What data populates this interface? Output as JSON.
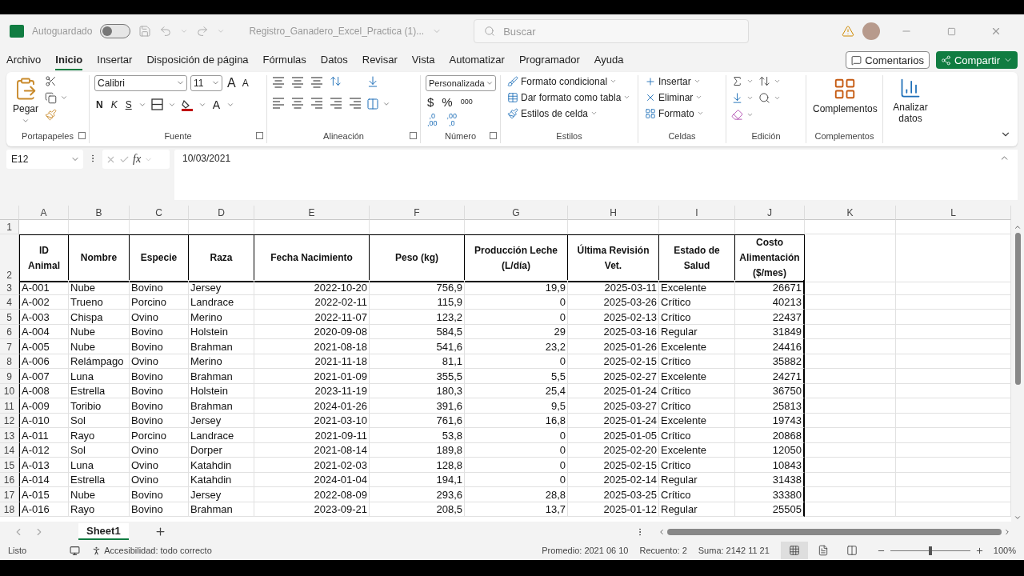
{
  "title_bar": {
    "autosave_label": "Autoguardado",
    "autosave_on": false,
    "file_name": "Registro_Ganadero_Excel_Practica (1)...",
    "search_placeholder": "Buscar"
  },
  "menu_tabs": [
    {
      "label": "Archivo",
      "selected": false
    },
    {
      "label": "Inicio",
      "selected": true
    },
    {
      "label": "Insertar",
      "selected": false
    },
    {
      "label": "Disposición de página",
      "selected": false
    },
    {
      "label": "Fórmulas",
      "selected": false
    },
    {
      "label": "Datos",
      "selected": false
    },
    {
      "label": "Revisar",
      "selected": false
    },
    {
      "label": "Vista",
      "selected": false
    },
    {
      "label": "Automatizar",
      "selected": false
    },
    {
      "label": "Programador",
      "selected": false
    },
    {
      "label": "Ayuda",
      "selected": false
    }
  ],
  "comments_button": "Comentarios",
  "share_button": "Compartir",
  "ribbon": {
    "clipboard": {
      "label": "Portapapeles",
      "launcher": true,
      "paste": "Pegar"
    },
    "font": {
      "label": "Fuente",
      "launcher": true,
      "font_name": "Calibri",
      "font_size": "11",
      "grow": "A",
      "shrink": "A",
      "bold": "N",
      "italic": "K",
      "underline": "S",
      "font_color": "A"
    },
    "alignment": {
      "label": "Alineación",
      "launcher": true
    },
    "number": {
      "label": "Número",
      "launcher": true,
      "format": "Personalizada",
      "currency": "$",
      "percent": "%",
      "thousands": "000",
      "decimals": [
        {
          "top": ",0",
          "bottom": ",00"
        },
        {
          "top": ",00",
          "bottom": ",0"
        }
      ]
    },
    "styles": {
      "label": "Estilos",
      "launcher": false,
      "items": [
        "Formato condicional",
        "Dar formato como tabla",
        "Estilos de celda"
      ]
    },
    "cells": {
      "label": "Celdas",
      "launcher": false,
      "items": [
        "Insertar",
        "Eliminar",
        "Formato"
      ]
    },
    "editing": {
      "label": "Edición",
      "launcher": false
    },
    "addins": {
      "label": "Complementos",
      "launcher": false,
      "button": "Complementos"
    },
    "analyze": {
      "button": "Analizar datos"
    }
  },
  "formula_bar": {
    "name_box": "E12",
    "function_symbol": "fx",
    "formula": "10/03/2021"
  },
  "sheet": {
    "columns": [
      {
        "letter": "A",
        "header": "ID\nAnimal"
      },
      {
        "letter": "B",
        "header": "Nombre"
      },
      {
        "letter": "C",
        "header": "Especie"
      },
      {
        "letter": "D",
        "header": "Raza"
      },
      {
        "letter": "E",
        "header": "Fecha Nacimiento"
      },
      {
        "letter": "F",
        "header": "Peso (kg)"
      },
      {
        "letter": "G",
        "header": "Producción Leche\n(L/día)"
      },
      {
        "letter": "H",
        "header": "Última Revisión\nVet."
      },
      {
        "letter": "I",
        "header": "Estado de\nSalud"
      },
      {
        "letter": "J",
        "header": "Costo\nAlimentación\n($/mes)"
      },
      {
        "letter": "K"
      },
      {
        "letter": "L"
      }
    ],
    "header_row_numbers": [
      "1",
      "2"
    ],
    "rows": [
      {
        "number": "3",
        "cells": [
          "A-001",
          "Nube",
          "Bovino",
          "Jersey",
          "2022-10-20",
          "756,9",
          "19,9",
          "2025-03-11",
          "Excelente",
          "26671"
        ]
      },
      {
        "number": "4",
        "cells": [
          "A-002",
          "Trueno",
          "Porcino",
          "Landrace",
          "2022-02-11",
          "115,9",
          "0",
          "2025-03-26",
          "Crítico",
          "40213"
        ]
      },
      {
        "number": "5",
        "cells": [
          "A-003",
          "Chispa",
          "Ovino",
          "Merino",
          "2022-11-07",
          "123,2",
          "0",
          "2025-02-13",
          "Crítico",
          "22437"
        ]
      },
      {
        "number": "6",
        "cells": [
          "A-004",
          "Nube",
          "Bovino",
          "Holstein",
          "2020-09-08",
          "584,5",
          "29",
          "2025-03-16",
          "Regular",
          "31849"
        ]
      },
      {
        "number": "7",
        "cells": [
          "A-005",
          "Nube",
          "Bovino",
          "Brahman",
          "2021-08-18",
          "541,6",
          "23,2",
          "2025-01-26",
          "Excelente",
          "24416"
        ]
      },
      {
        "number": "8",
        "cells": [
          "A-006",
          "Relámpago",
          "Ovino",
          "Merino",
          "2021-11-18",
          "81,1",
          "0",
          "2025-02-15",
          "Crítico",
          "35882"
        ]
      },
      {
        "number": "9",
        "cells": [
          "A-007",
          "Luna",
          "Bovino",
          "Brahman",
          "2021-01-09",
          "355,5",
          "5,5",
          "2025-02-27",
          "Excelente",
          "24271"
        ]
      },
      {
        "number": "10",
        "cells": [
          "A-008",
          "Estrella",
          "Bovino",
          "Holstein",
          "2023-11-19",
          "180,3",
          "25,4",
          "2025-01-24",
          "Crítico",
          "36750"
        ]
      },
      {
        "number": "11",
        "cells": [
          "A-009",
          "Toribio",
          "Bovino",
          "Brahman",
          "2024-01-26",
          "391,6",
          "9,5",
          "2025-03-27",
          "Crítico",
          "25813"
        ]
      },
      {
        "number": "12",
        "cells": [
          "A-010",
          "Sol",
          "Bovino",
          "Jersey",
          "2021-03-10",
          "761,6",
          "16,8",
          "2025-01-24",
          "Excelente",
          "19743"
        ]
      },
      {
        "number": "13",
        "cells": [
          "A-011",
          "Rayo",
          "Porcino",
          "Landrace",
          "2021-09-11",
          "53,8",
          "0",
          "2025-01-05",
          "Crítico",
          "20868"
        ]
      },
      {
        "number": "14",
        "cells": [
          "A-012",
          "Sol",
          "Ovino",
          "Dorper",
          "2021-08-14",
          "189,8",
          "0",
          "2025-02-20",
          "Excelente",
          "12050"
        ]
      },
      {
        "number": "15",
        "cells": [
          "A-013",
          "Luna",
          "Ovino",
          "Katahdin",
          "2021-02-03",
          "128,8",
          "0",
          "2025-02-15",
          "Crítico",
          "10843"
        ]
      },
      {
        "number": "16",
        "cells": [
          "A-014",
          "Estrella",
          "Ovino",
          "Katahdin",
          "2024-01-04",
          "194,1",
          "0",
          "2025-02-14",
          "Regular",
          "31438"
        ]
      },
      {
        "number": "17",
        "cells": [
          "A-015",
          "Nube",
          "Bovino",
          "Jersey",
          "2022-08-09",
          "293,6",
          "28,8",
          "2025-03-25",
          "Crítico",
          "33380"
        ]
      },
      {
        "number": "18",
        "cells": [
          "A-016",
          "Rayo",
          "Bovino",
          "Brahman",
          "2023-09-21",
          "208,5",
          "13,7",
          "2025-01-12",
          "Regular",
          "25505"
        ]
      }
    ]
  },
  "sheet_tabs": [
    {
      "label": "Sheet1",
      "selected": true
    }
  ],
  "status_bar": {
    "ready": "Listo",
    "accessibility": "Accesibilidad: todo correcto",
    "average": "Promedio: 2021 06 10",
    "count": "Recuento: 2",
    "sum": "Suma: 2142 11 21",
    "views": [
      {
        "kind": "normal",
        "selected": true
      },
      {
        "kind": "page_layout",
        "selected": false
      },
      {
        "kind": "page_break",
        "selected": false
      }
    ],
    "zoom_slider": {
      "level": 0.5
    },
    "zoom": "100%"
  }
}
